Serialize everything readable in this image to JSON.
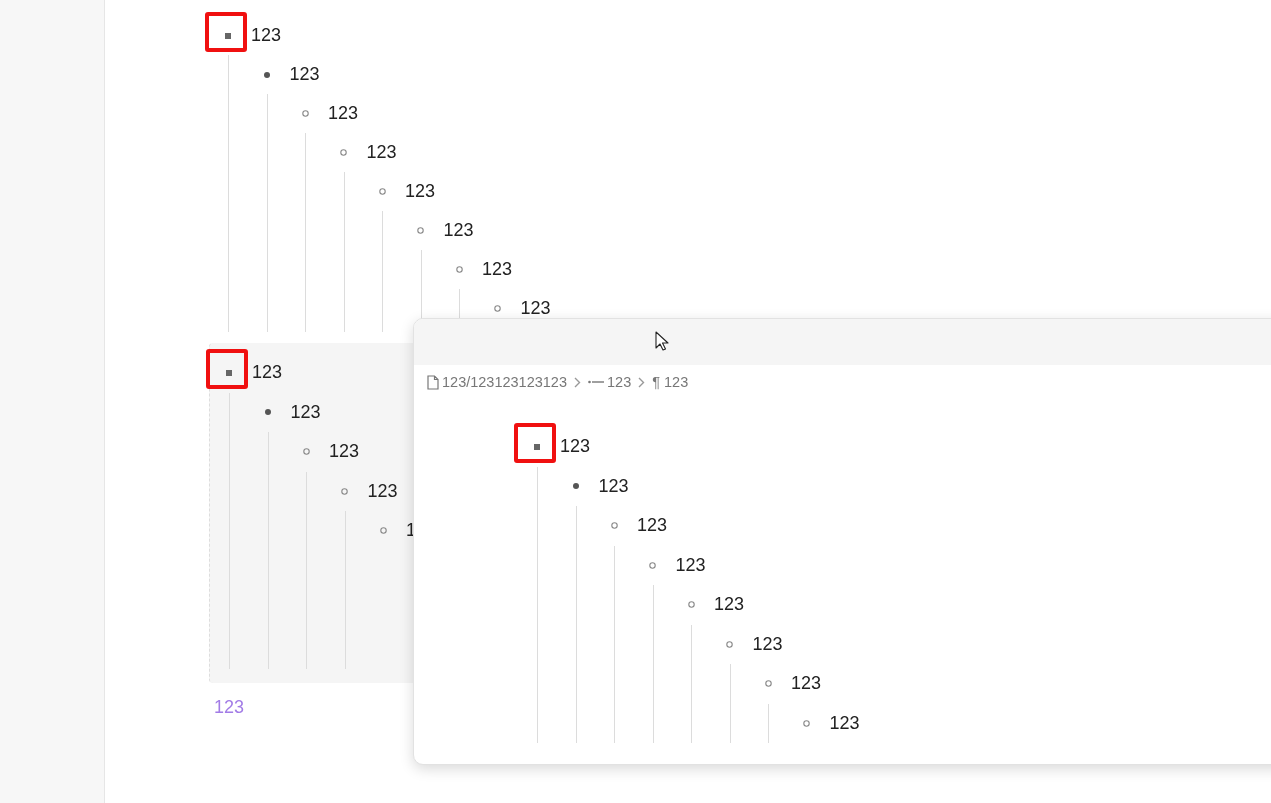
{
  "outline_top": {
    "items": [
      {
        "text": "123",
        "kind": "square",
        "highlighted": true,
        "children": [
          {
            "text": "123",
            "kind": "disc",
            "children": [
              {
                "text": "123",
                "kind": "circle",
                "children": [
                  {
                    "text": "123",
                    "kind": "circle",
                    "children": [
                      {
                        "text": "123",
                        "kind": "circle",
                        "children": [
                          {
                            "text": "123",
                            "kind": "circle",
                            "children": [
                              {
                                "text": "123",
                                "kind": "circle",
                                "children": [
                                  {
                                    "text": "123",
                                    "kind": "circle"
                                  }
                                ]
                              }
                            ]
                          }
                        ]
                      }
                    ]
                  }
                ]
              }
            ]
          }
        ]
      }
    ]
  },
  "outline_block": {
    "items": [
      {
        "text": "123",
        "kind": "square",
        "highlighted": true,
        "children": [
          {
            "text": "123",
            "kind": "disc",
            "children": [
              {
                "text": "123",
                "kind": "circle",
                "children": [
                  {
                    "text": "123",
                    "kind": "circle",
                    "children": [
                      {
                        "text": "1",
                        "kind": "circle"
                      }
                    ]
                  }
                ]
              }
            ]
          }
        ]
      }
    ]
  },
  "footer_link": "123",
  "popup": {
    "breadcrumb": [
      {
        "kind": "file",
        "label": "123/123123123123"
      },
      {
        "kind": "list",
        "label": "123"
      },
      {
        "kind": "paragraph",
        "label": "¶ 123"
      }
    ],
    "items": [
      {
        "text": "123",
        "kind": "square",
        "highlighted": true,
        "children": [
          {
            "text": "123",
            "kind": "disc",
            "children": [
              {
                "text": "123",
                "kind": "circle",
                "children": [
                  {
                    "text": "123",
                    "kind": "circle",
                    "children": [
                      {
                        "text": "123",
                        "kind": "circle",
                        "children": [
                          {
                            "text": "123",
                            "kind": "circle",
                            "children": [
                              {
                                "text": "123",
                                "kind": "circle",
                                "children": [
                                  {
                                    "text": "123",
                                    "kind": "circle"
                                  }
                                ]
                              }
                            ]
                          }
                        ]
                      }
                    ]
                  }
                ]
              }
            ]
          }
        ]
      }
    ]
  }
}
